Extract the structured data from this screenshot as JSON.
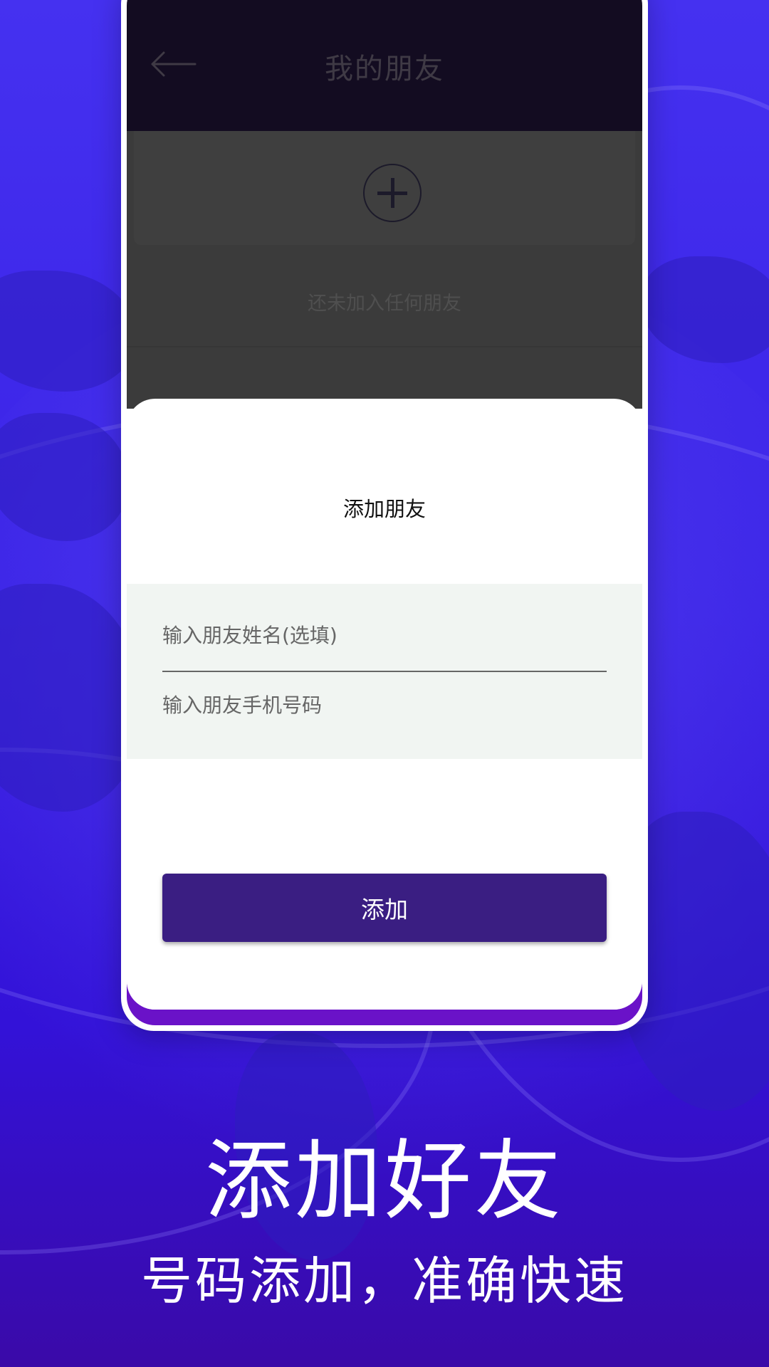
{
  "app": {
    "page_title": "我的朋友",
    "empty_state": "还未加入任何朋友"
  },
  "sheet": {
    "title": "添加朋友",
    "name_placeholder": "输入朋友姓名(选填)",
    "phone_placeholder": "输入朋友手机号码",
    "add_button": "添加"
  },
  "promo": {
    "headline": "添加好友",
    "subhead": "号码添加，准确快速"
  },
  "colors": {
    "accent": "#3a1e82",
    "background": "#3a22e6"
  }
}
